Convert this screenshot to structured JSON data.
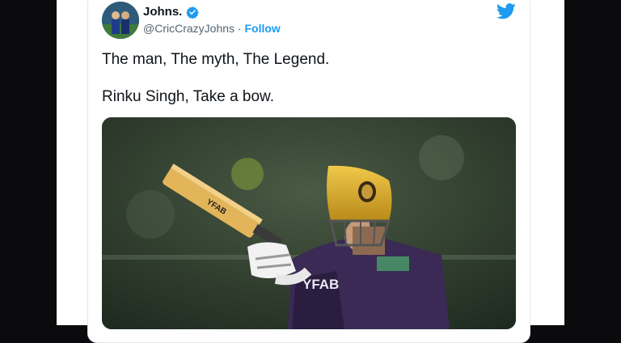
{
  "tweet": {
    "author_name": "Johns.",
    "handle": "@CricCrazyJohns",
    "separator": "·",
    "follow_label": "Follow",
    "lines": [
      "The man, The myth, The Legend.",
      "Rinku Singh, Take a bow."
    ]
  },
  "colors": {
    "twitter_blue": "#1d9bf0",
    "text": "#0f1419",
    "muted": "#536471",
    "helmet_gold": "#d4a62a",
    "jersey_purple": "#3a2a55"
  },
  "icons": [
    "verified-badge-icon",
    "twitter-bird-icon"
  ],
  "media": {
    "bat_text": "YFAB"
  }
}
